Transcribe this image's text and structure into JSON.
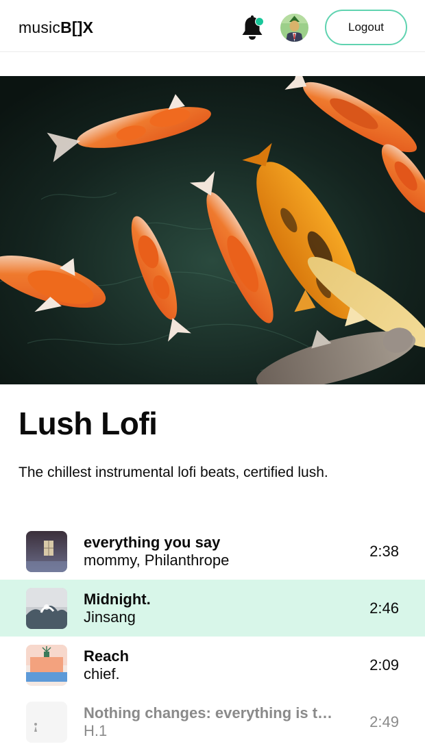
{
  "header": {
    "logo_prefix": "music",
    "logo_suffix": "B[]X",
    "logout_label": "Logout",
    "notification_dot_color": "#19c79a"
  },
  "playlist": {
    "title": "Lush Lofi",
    "description": "The chillest instrumental lofi beats, certified lush."
  },
  "tracks": [
    {
      "title": "everything you say",
      "artist": "mommy, Philanthrope",
      "duration": "2:38",
      "state": "normal"
    },
    {
      "title": "Midnight.",
      "artist": "Jinsang",
      "duration": "2:46",
      "state": "active"
    },
    {
      "title": "Reach",
      "artist": "chief.",
      "duration": "2:09",
      "state": "normal"
    },
    {
      "title": "Nothing changes: everything is the same",
      "artist": "H.1",
      "duration": "2:49",
      "state": "dim"
    }
  ],
  "colors": {
    "accent": "#5fd3b0",
    "active_row": "#d8f6e9"
  }
}
